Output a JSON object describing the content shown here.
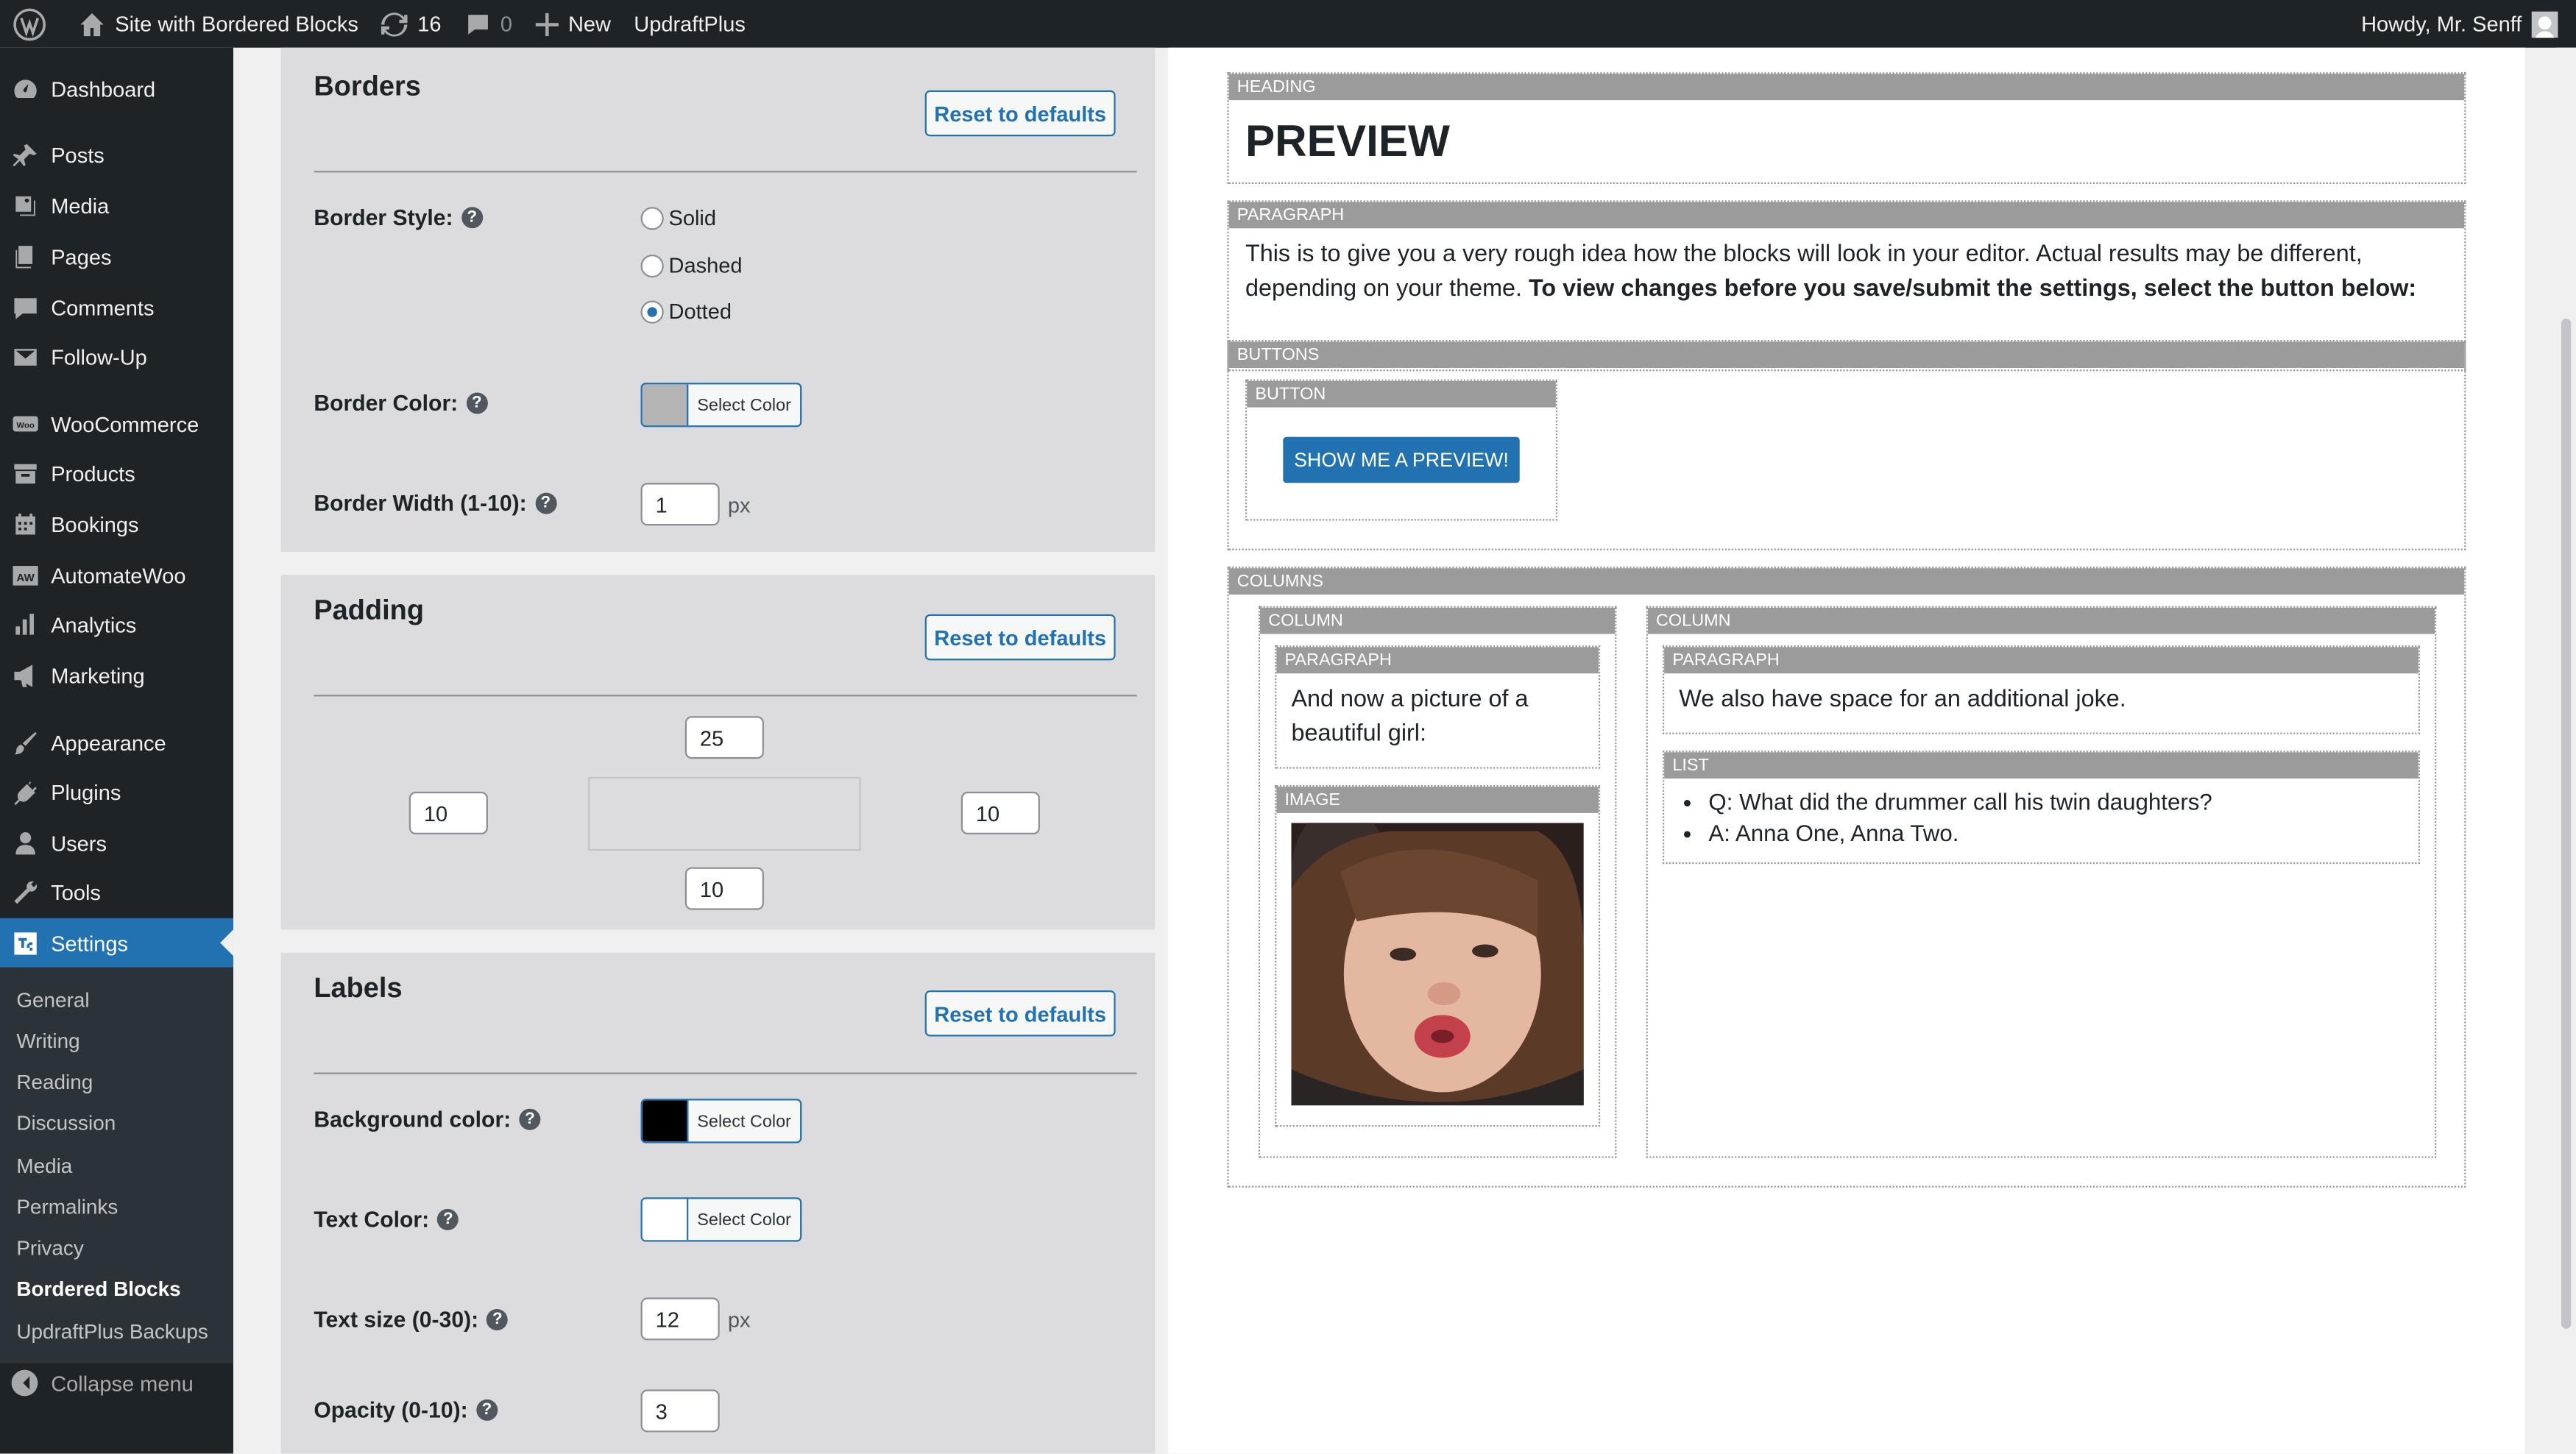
{
  "admin_bar": {
    "site_name": "Site with Bordered Blocks",
    "updates_count": "16",
    "comments_count": "0",
    "new_label": "New",
    "plugin_label": "UpdraftPlus",
    "greeting": "Howdy, Mr. Senff"
  },
  "sidebar": {
    "items": [
      {
        "label": "Dashboard",
        "icon": "dashboard-icon"
      },
      {
        "label": "Posts",
        "icon": "pin-icon"
      },
      {
        "label": "Media",
        "icon": "media-icon"
      },
      {
        "label": "Pages",
        "icon": "pages-icon"
      },
      {
        "label": "Comments",
        "icon": "comment-icon"
      },
      {
        "label": "Follow-Up",
        "icon": "mail-icon"
      },
      {
        "label": "WooCommerce",
        "icon": "woo-icon"
      },
      {
        "label": "Products",
        "icon": "archive-icon"
      },
      {
        "label": "Bookings",
        "icon": "calendar-icon"
      },
      {
        "label": "AutomateWoo",
        "icon": "aw-icon"
      },
      {
        "label": "Analytics",
        "icon": "bar-chart-icon"
      },
      {
        "label": "Marketing",
        "icon": "megaphone-icon"
      },
      {
        "label": "Appearance",
        "icon": "brush-icon"
      },
      {
        "label": "Plugins",
        "icon": "plug-icon"
      },
      {
        "label": "Users",
        "icon": "user-icon"
      },
      {
        "label": "Tools",
        "icon": "wrench-icon"
      },
      {
        "label": "Settings",
        "icon": "settings-icon"
      }
    ],
    "submenu": [
      "General",
      "Writing",
      "Reading",
      "Discussion",
      "Media",
      "Permalinks",
      "Privacy",
      "Bordered Blocks",
      "UpdraftPlus Backups"
    ],
    "collapse_label": "Collapse menu"
  },
  "borders": {
    "title": "Borders",
    "reset_label": "Reset to defaults",
    "style_label": "Border Style:",
    "style_options": [
      "Solid",
      "Dashed",
      "Dotted"
    ],
    "style_selected": "Dotted",
    "color_label": "Border Color:",
    "color_value": "#b4b4b4",
    "select_color_label": "Select Color",
    "width_label": "Border Width (1-10):",
    "width_value": "1",
    "unit": "px"
  },
  "padding": {
    "title": "Padding",
    "reset_label": "Reset to defaults",
    "top": "25",
    "left": "10",
    "right": "10",
    "bottom": "10"
  },
  "labels": {
    "title": "Labels",
    "reset_label": "Reset to defaults",
    "bg_label": "Background color:",
    "bg_value": "#000000",
    "text_color_label": "Text Color:",
    "text_color_value": "#ffffff",
    "select_color_label": "Select Color",
    "size_label": "Text size (0-30):",
    "size_value": "12",
    "unit": "px",
    "opacity_label": "Opacity (0-10):",
    "opacity_value": "3"
  },
  "preview": {
    "heading_label": "HEADING",
    "heading_text": "PREVIEW",
    "paragraph_label": "PARAGRAPH",
    "paragraph_text": "This is to give you a very rough idea how the blocks will look in your editor. Actual results may be different, depending on your theme. ",
    "paragraph_bold": "To view changes before you save/submit the settings, select the button below:",
    "buttons_label": "BUTTONS",
    "button_label": "BUTTON",
    "button_text": "SHOW ME A PREVIEW!",
    "columns_label": "COLUMNS",
    "column_label": "COLUMN",
    "col1_paragraph": "And now a picture of a beautiful girl:",
    "image_label": "IMAGE",
    "col2_paragraph": "We also have space for an additional joke.",
    "list_label": "LIST",
    "list_items": [
      "Q: What did the drummer call his twin daughters?",
      "A: Anna One, Anna Two."
    ]
  }
}
